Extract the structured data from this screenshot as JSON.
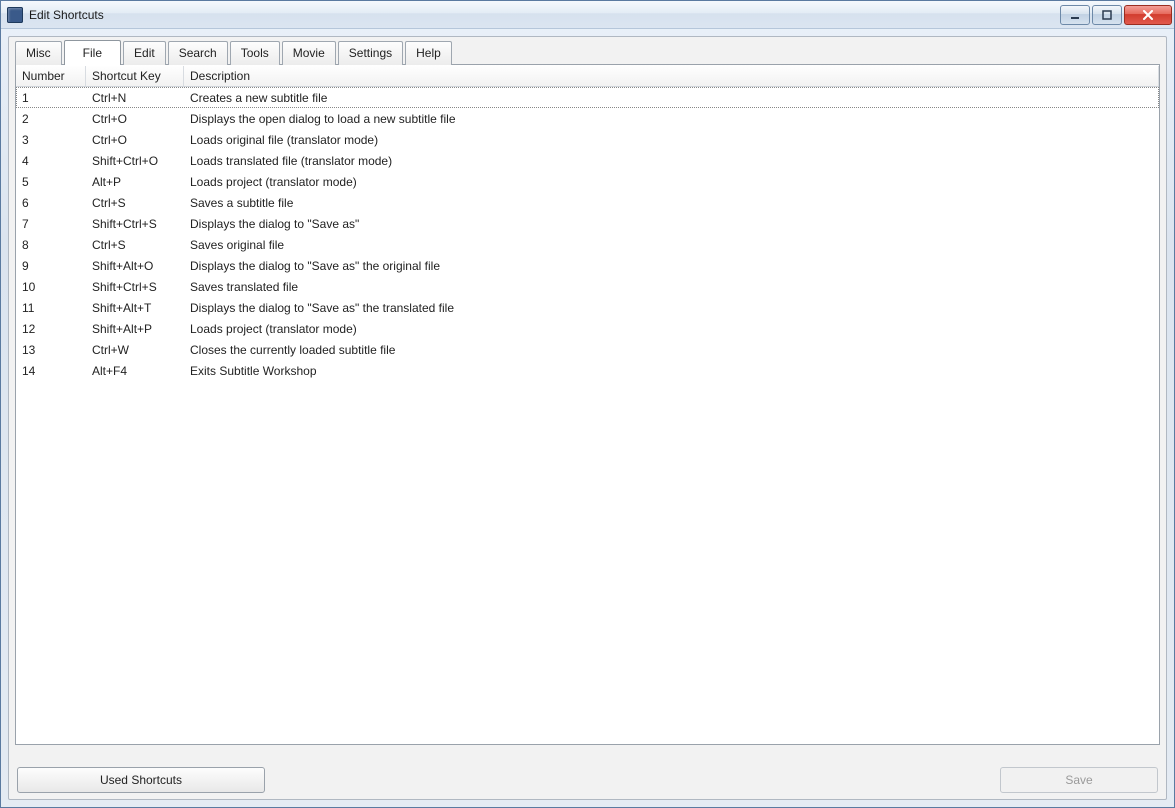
{
  "window": {
    "title": "Edit Shortcuts"
  },
  "tabs": [
    {
      "label": "Misc",
      "active": false
    },
    {
      "label": "File",
      "active": true
    },
    {
      "label": "Edit",
      "active": false
    },
    {
      "label": "Search",
      "active": false
    },
    {
      "label": "Tools",
      "active": false
    },
    {
      "label": "Movie",
      "active": false
    },
    {
      "label": "Settings",
      "active": false
    },
    {
      "label": "Help",
      "active": false
    }
  ],
  "columns": {
    "number": "Number",
    "shortcut": "Shortcut Key",
    "description": "Description"
  },
  "rows": [
    {
      "number": "1",
      "key": "Ctrl+N",
      "desc": "Creates a new subtitle file",
      "selected": true
    },
    {
      "number": "2",
      "key": "Ctrl+O",
      "desc": "Displays the open dialog to load a new subtitle file"
    },
    {
      "number": "3",
      "key": "Ctrl+O",
      "desc": "Loads original file (translator mode)"
    },
    {
      "number": "4",
      "key": "Shift+Ctrl+O",
      "desc": "Loads translated file (translator mode)"
    },
    {
      "number": "5",
      "key": "Alt+P",
      "desc": "Loads project (translator mode)"
    },
    {
      "number": "6",
      "key": "Ctrl+S",
      "desc": "Saves a subtitle file"
    },
    {
      "number": "7",
      "key": "Shift+Ctrl+S",
      "desc": "Displays the dialog to \"Save as\""
    },
    {
      "number": "8",
      "key": "Ctrl+S",
      "desc": "Saves original file"
    },
    {
      "number": "9",
      "key": "Shift+Alt+O",
      "desc": "Displays the dialog to \"Save as\" the original file"
    },
    {
      "number": "10",
      "key": "Shift+Ctrl+S",
      "desc": "Saves translated file"
    },
    {
      "number": "11",
      "key": "Shift+Alt+T",
      "desc": "Displays the dialog to \"Save as\" the translated file"
    },
    {
      "number": "12",
      "key": "Shift+Alt+P",
      "desc": "Loads project (translator mode)"
    },
    {
      "number": "13",
      "key": "Ctrl+W",
      "desc": "Closes the currently loaded subtitle file"
    },
    {
      "number": "14",
      "key": "Alt+F4",
      "desc": "Exits Subtitle Workshop"
    }
  ],
  "buttons": {
    "used_shortcuts": "Used Shortcuts",
    "save": "Save"
  }
}
